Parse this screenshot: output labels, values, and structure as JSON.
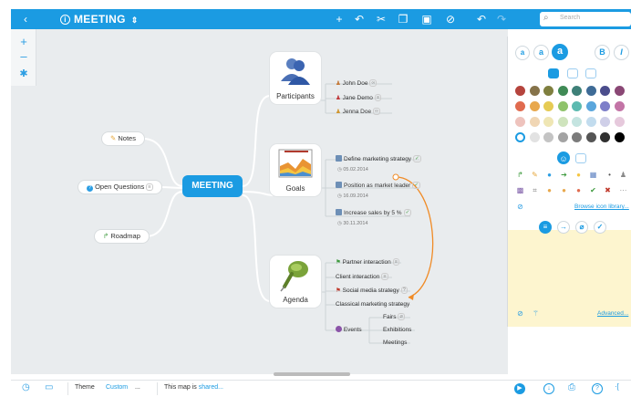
{
  "toolbar": {
    "back_icon": "chevron-left-icon",
    "title": "MEETING",
    "title_menu_icon": "updown-icon",
    "tools": [
      "add-icon",
      "connect-icon",
      "cut-icon",
      "copy-icon",
      "paste-icon",
      "no-icon",
      "undo-icon",
      "redo-icon"
    ],
    "search_placeholder": "Search"
  },
  "left_tools": [
    "zoom-in-icon",
    "zoom-out-icon",
    "settings-icon"
  ],
  "map": {
    "central": "MEETING",
    "left_topics": [
      {
        "label": "Notes",
        "icon": "pencil-icon"
      },
      {
        "label": "Open Questions",
        "icon": "question-icon"
      },
      {
        "label": "Roadmap",
        "icon": "arrow-icon"
      }
    ],
    "participants": {
      "label": "Participants",
      "items": [
        "John Doe",
        "Jane Demo",
        "Jenna Doe"
      ]
    },
    "goals": {
      "label": "Goals",
      "items": [
        {
          "label": "Define marketing strategy",
          "date": "05.02.2014"
        },
        {
          "label": "Position as market leader",
          "date": "16.09.2014"
        },
        {
          "label": "Increase sales by 5 %",
          "date": "30.11.2014"
        }
      ]
    },
    "agenda": {
      "label": "Agenda",
      "items": [
        "Partner interaction",
        "Client interaction",
        "Social media strategy",
        "Classical marketing strategy",
        "Events"
      ],
      "events_children": [
        "Fairs",
        "Exhibitions",
        "Meetings"
      ]
    }
  },
  "panel": {
    "font_buttons": [
      "a",
      "a",
      "a",
      "B",
      "I"
    ],
    "colors": [
      "#b5443d",
      "#86734a",
      "#7f7f3f",
      "#3f8a55",
      "#3e8078",
      "#3e6b96",
      "#4b4d8c",
      "#8a4775",
      "#e06b4f",
      "#e8a84d",
      "#e6cb54",
      "#8fc36a",
      "#5cbab0",
      "#5aa6dc",
      "#7d7ec9",
      "#c374a6",
      "#eec3bd",
      "#f0d6b4",
      "#efe6b4",
      "#cfe4bd",
      "#c4e4e0",
      "#c2dcee",
      "#cfcfe8",
      "#e6c9dc",
      "#ffffff",
      "#e2e2e2",
      "#c4c4c4",
      "#a3a3a3",
      "#7b7b7b",
      "#555555",
      "#303030",
      "#000000"
    ],
    "browse_link": "Browse icon library...",
    "advanced_link": "Advanced..."
  },
  "bottombar": {
    "theme_label": "Theme",
    "theme_value": "Custom",
    "more": "...",
    "shared_text": "This map is",
    "shared_link": "shared..."
  }
}
